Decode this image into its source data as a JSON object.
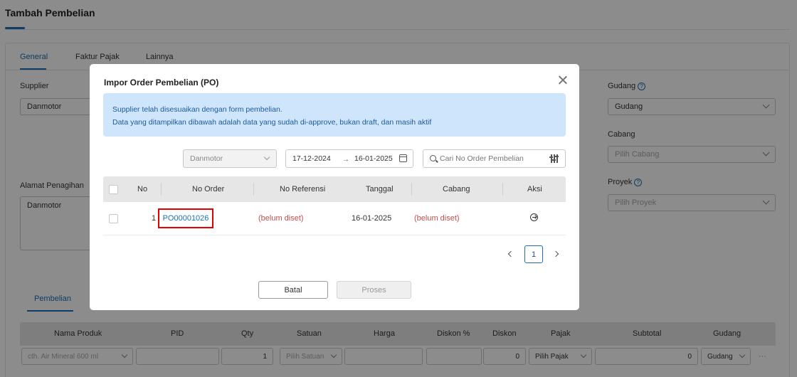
{
  "page": {
    "title": "Tambah Pembelian",
    "tabs": [
      "General",
      "Faktur Pajak",
      "Lainnya"
    ],
    "supplier_label": "Supplier",
    "supplier_value": "Danmotor",
    "billing_label": "Alamat Penagihan",
    "billing_value": "Danmotor",
    "warehouse_label": "Gudang",
    "warehouse_value": "Gudang",
    "branch_label": "Cabang",
    "branch_placeholder": "Pilih Cabang",
    "project_label": "Proyek",
    "project_placeholder": "Pilih Proyek",
    "sub_tab": "Pembelian",
    "table_headers": [
      "Nama Produk",
      "PID",
      "Qty",
      "Satuan",
      "Harga",
      "Diskon %",
      "Diskon",
      "Pajak",
      "Subtotal",
      "Gudang"
    ],
    "row": {
      "product_placeholder": "cth. Air Mineral 600 ml",
      "qty": "1",
      "unit_placeholder": "Pilih Satuan",
      "discount": "0",
      "tax_placeholder": "Pilih Pajak",
      "subtotal": "0",
      "warehouse": "Gudang",
      "more": "···"
    }
  },
  "modal": {
    "title": "Impor Order Pembelian (PO)",
    "info_line1": "Supplier telah disesuaikan dengan form pembelian.",
    "info_line2": "Data yang ditampilkan dibawah adalah data yang sudah di-approve, bukan draft, dan masih aktif",
    "supplier_filter": "Danmotor",
    "date_from": "17-12-2024",
    "date_to": "16-01-2025",
    "date_arrow": "→",
    "search_placeholder": "Cari No Order Pembelian",
    "columns": [
      "No",
      "No Order",
      "No Referensi",
      "Tanggal",
      "Cabang",
      "Aksi"
    ],
    "rows": [
      {
        "no": "1",
        "order": "PO00001026",
        "reference": "(belum diset)",
        "date": "16-01-2025",
        "branch": "(belum diset)"
      }
    ],
    "pagination": {
      "current": "1"
    },
    "cancel_label": "Batal",
    "process_label": "Proses"
  },
  "colors": {
    "accent": "#1a6fb8",
    "info_bg": "#cfe5fb",
    "warning_text": "#c0504d",
    "highlight": "#e00000"
  }
}
